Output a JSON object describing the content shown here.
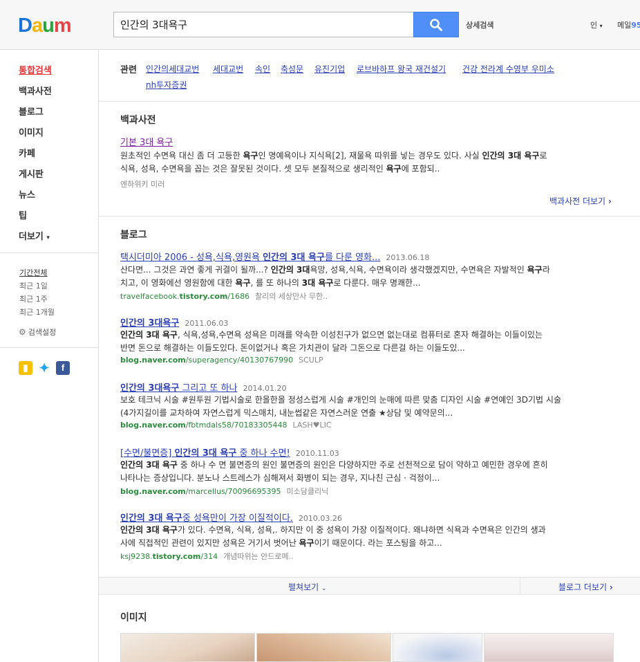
{
  "header": {
    "logo": [
      "D",
      "a",
      "u",
      "m"
    ],
    "search_value": "인간의 3대욕구",
    "detail_search": "상세검색",
    "user_label": "인",
    "mail_label": "메일",
    "mail_count": "95"
  },
  "nav": {
    "items": [
      "통합검색",
      "백과사전",
      "블로그",
      "이미지",
      "카페",
      "게시판",
      "뉴스",
      "팁",
      "더보기"
    ],
    "periods": [
      "기간전체",
      "최근 1일",
      "최근 1주",
      "최근 1개월"
    ],
    "search_setting": "검색설정"
  },
  "related": {
    "label": "관련",
    "links": [
      "인간의세대교번",
      "세대교번",
      "속인",
      "축성문",
      "유진기업",
      "로브바하프 왕국 재건설기",
      "건강 전라계 수영부 우미소",
      "nh투자증권"
    ]
  },
  "encyclopedia": {
    "title": "백과사전",
    "result": {
      "title": "기본 3대 욕구",
      "line1_a": "원초적인 수면욕 대신 좀 더 고등한 ",
      "line1_b": "욕구",
      "line1_c": "인 명예욕이나 지식욕[2], 재물욕 따위를 넣는 경우도 있다. 사실 ",
      "line1_d": "인간의 3대 욕구",
      "line1_e": "로",
      "line2_a": "식욕, 성욕, 수면욕을 꼽는 것은 잘못된 것이다. 셋 모두 본질적으로 생리적인 ",
      "line2_b": "욕구",
      "line2_c": "에 포함되..",
      "source": "엔하위키 미러"
    },
    "more": "백과사전 더보기"
  },
  "blog": {
    "title": "블로그",
    "results": [
      {
        "title_a": "택시더미아 2006 - 성욕,식욕,영원욕 ",
        "title_b": "인간의 3대 욕구",
        "title_c": "를 다룬 영화...",
        "date": "2013.06.18",
        "l1_a": "산다면... 그것은 과연 좋게 귀결이 될까...? ",
        "l1_b": "인간의 3대",
        "l1_c": "욕망, 성욕,식욕, 수면욕이라 생각했겠지만, 수면욕은 자발적인 ",
        "l1_d": "욕구",
        "l1_e": "라",
        "l2_a": "치고, 이 영화에선 영원함에 대한 ",
        "l2_b": "욕구",
        "l2_c": ", 를 또 하나의 ",
        "l2_d": "3대 욕구",
        "l2_e": "로 다룬다. 매우 명쾌한...",
        "url_a": "travelfacebook.",
        "url_b": "tistory.com",
        "url_c": "/1686",
        "src": "찰리의 세상만사 무한.."
      },
      {
        "title_a": "",
        "title_b": "인간의 3대욕구",
        "title_c": "",
        "date": "2011.06.03",
        "l1_a": "",
        "l1_b": "인간의 3대 욕구",
        "l1_c": ", 식욕,성욕,수면욕 성욕은 미래를 약속한 이성친구가 없으면 없는대로 컴퓨터로 혼자 해결하는 이들이있는",
        "l1_d": "",
        "l1_e": "",
        "l2_a": "반면 돈으로 해결하는 이들도있다. 돈이없거나 혹은 가치관이 달라 그돈으로 다른걸 하는 이들도있...",
        "l2_b": "",
        "l2_c": "",
        "l2_d": "",
        "l2_e": "",
        "url_a": "",
        "url_b": "blog.naver.com",
        "url_c": "/superagency/40130767990",
        "src": "SCULP"
      },
      {
        "title_a": "",
        "title_b": "인간의 3대욕구",
        "title_c": " 그리고 또 하나",
        "date": "2014.01.20",
        "l1_a": "보호 테크닉 시술 #원투원 기법시술로 한올한올 정성스럽게 시술 #개인의 눈매에 따른 맞춤 디자인 시술 #연예인 3D기법 시술",
        "l1_b": "",
        "l1_c": "",
        "l1_d": "",
        "l1_e": "",
        "l2_a": "(4가지길이를 교차하여 자연스럽게 믹스매치, 내눈썹같은 자연스러운 연출 ★상담 및 예약문의...",
        "l2_b": "",
        "l2_c": "",
        "l2_d": "",
        "l2_e": "",
        "url_a": "",
        "url_b": "blog.naver.com",
        "url_c": "/fbtmdals58/70183305448",
        "src": "LASH♥LIC"
      },
      {
        "title_a": "[수면/불면증] ",
        "title_b": "인간의 3대 욕구",
        "title_c": " 중 하나 수면!",
        "date": "2010.11.03",
        "l1_a": "",
        "l1_b": "인간의 3대 욕구",
        "l1_c": " 중 하나 수 면 불면증의 원인 불면증의 원인은 다양하지만 주로 선천적으로 담이 약하고 예민한 경우에 흔히",
        "l1_d": "",
        "l1_e": "",
        "l2_a": "나타나는 증상입니다. 분노나 스트레스가 심해져서 화병이 되는 경우, 지나친 근심 · 걱정이...",
        "l2_b": "",
        "l2_c": "",
        "l2_d": "",
        "l2_e": "",
        "url_a": "",
        "url_b": "blog.naver.com",
        "url_c": "/marcellus/70096695395",
        "src": "미소담클리닉"
      },
      {
        "title_a": "",
        "title_b": "인간의 3대 욕구",
        "title_c": "중 성욕만이 가장 이질적이다.",
        "date": "2010.03.26",
        "l1_a": "",
        "l1_b": "인간의 3대 욕구",
        "l1_c": "가 있다. 수면욕, 식욕, 성욕,. 하지만 이 중 성욕이 가장 이질적이다. 왜냐하면 식욕과 수면욕은 인간의 생과",
        "l1_d": "",
        "l1_e": "",
        "l2_a": "사에 직접적인 관련이 있지만 성욕은 거기서 벗어난 ",
        "l2_b": "욕구",
        "l2_c": "이기 때문이다. 라는 포스팅을 하고...",
        "l2_d": "",
        "l2_e": "",
        "url_a": "ksj9238.",
        "url_b": "tistory.com",
        "url_c": "/314",
        "src": "개념따위는 안드로메.."
      }
    ],
    "expand": "펼쳐보기",
    "more": "블로그 더보기"
  },
  "images": {
    "title": "이미지"
  },
  "colors": {
    "accent": "#4f8ff7",
    "link": "#2b3fb3",
    "url": "#2a8a3a",
    "active_nav": "#e5383b"
  }
}
